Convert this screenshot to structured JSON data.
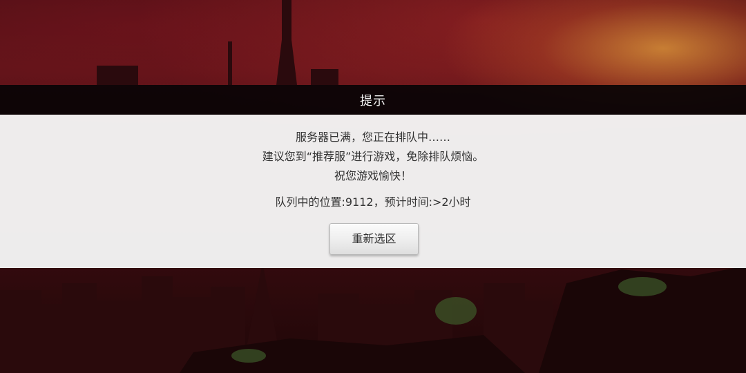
{
  "dialog": {
    "title": "提示",
    "lines": [
      "服务器已满，您正在排队中……",
      "建议您到“推荐服”进行游戏，免除排队烦恼。",
      "祝您游戏愉快！"
    ],
    "queue_text": "队列中的位置:9112，预计时间:>2小时",
    "reselect_button": "重新选区"
  },
  "colors": {
    "title_bar": "#080405",
    "panel": "#f4f4f4",
    "text": "#333333",
    "sky_glow": "#e6a03c"
  }
}
